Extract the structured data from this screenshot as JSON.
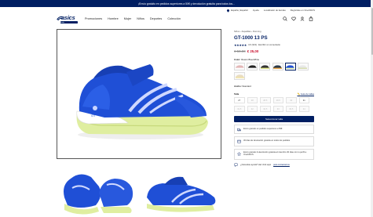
{
  "promo": {
    "text": "¡Envío gratuito en pedidos superiores a 50€ y devolución gratuita para todos los..."
  },
  "utility": {
    "location": "España | Español",
    "help": "Ayuda",
    "contact": "Localizador de tiendas",
    "newsletter": "Regístrate en OneASICS"
  },
  "header": {
    "logo": "asics",
    "logo_tagline": "sound mind, sound body",
    "nav": [
      "Promociones",
      "Hombre",
      "Mujer",
      "Niños",
      "Deportes",
      "Colección"
    ]
  },
  "product": {
    "breadcrumb": "Niños  ›  Zapatillas  ›  Running",
    "title": "GT-1000 13 PS",
    "stars": "★★★★★",
    "rating": "4.6 (321)",
    "write_review": "Escribir un comentario",
    "old_price": "€ 50,00",
    "new_price": "€ 25,00",
    "color_label": "Color:",
    "color_value": "Illusion Blue/White",
    "width_label": "Ancho:",
    "width_value": "Standard",
    "size_label": "Talla",
    "size_guide": "Guía de tallas",
    "sizes": [
      "27",
      "28",
      "28.5",
      "29.5",
      "30",
      "31",
      "31.5",
      "32",
      "32.5",
      "33",
      "33.5",
      "34"
    ],
    "sizes_available": [
      true,
      false,
      false,
      false,
      false,
      true,
      false,
      false,
      false,
      false,
      false,
      false
    ],
    "cta": "Seleccionar talla",
    "benefits": [
      "Envío gratuito en pedidos superiores a 50€",
      "30 días de devolución gratuita en todos los pedidos",
      "Envío gratuito & devolución gratuita al miembro 30 días con tu perfil a OneASICS"
    ],
    "help_text": "¿Necesitas ayuda? Haz click aquí",
    "help_link": "para contactarnos"
  },
  "colors": {
    "brand": "#001e62",
    "shoe_blue": "#1f4fd6",
    "sole_lime": "#dfeea0",
    "sale": "#c8102e"
  },
  "icons": [
    "pin-icon",
    "search-icon",
    "heart-icon",
    "user-icon",
    "bag-icon",
    "star-icon",
    "truck-icon",
    "return-icon",
    "gift-icon",
    "chat-icon"
  ]
}
